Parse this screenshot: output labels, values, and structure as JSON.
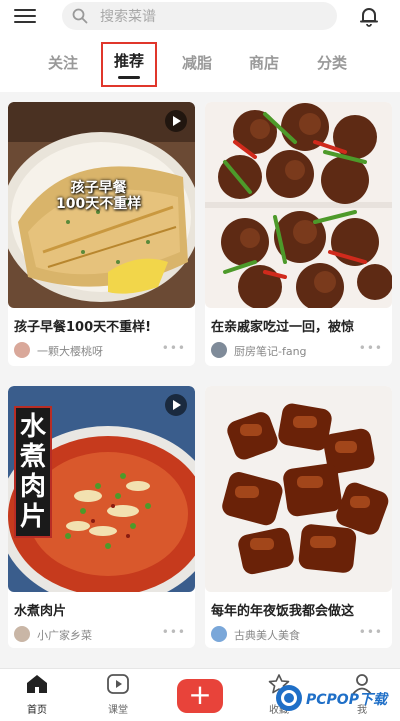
{
  "header": {
    "search_placeholder": "搜索菜谱"
  },
  "tabs": [
    {
      "label": "关注"
    },
    {
      "label": "推荐",
      "active": true
    },
    {
      "label": "减脂"
    },
    {
      "label": "商店"
    },
    {
      "label": "分类"
    }
  ],
  "feed": [
    {
      "title": "孩子早餐100天不重样!",
      "author": "一颗大樱桃呀",
      "overlay": "孩子早餐\n100天不重样",
      "video": true
    },
    {
      "title": "在亲戚家吃过一回，被惊",
      "author": "厨房笔记-fang",
      "video": false
    },
    {
      "title": "水煮肉片",
      "author": "小广家乡菜",
      "overlay": "水煮肉片",
      "video": true
    },
    {
      "title": "每年的年夜饭我都会做这",
      "author": "古典美人美食",
      "video": false
    }
  ],
  "bottom_nav": [
    {
      "label": "首页",
      "icon": "home-icon",
      "active": true
    },
    {
      "label": "课堂",
      "icon": "play-square-icon"
    },
    {
      "label": "",
      "icon": "plus-icon"
    },
    {
      "label": "收藏",
      "icon": "star-icon"
    },
    {
      "label": "我",
      "icon": "user-icon"
    }
  ],
  "watermark": {
    "text": "PCPOP下载"
  },
  "colors": {
    "accent": "#e8433a",
    "highlight_border": "#e0362b"
  }
}
